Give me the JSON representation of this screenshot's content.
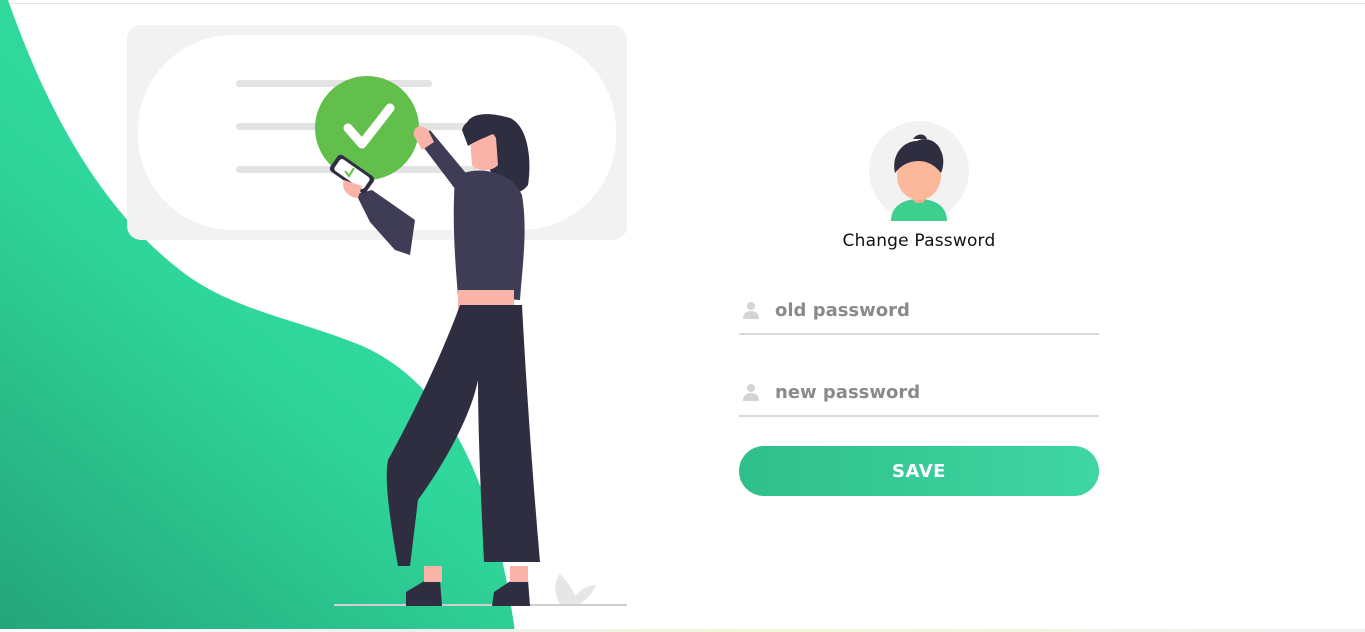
{
  "form": {
    "title": "Change Password",
    "old_password": {
      "value": "",
      "placeholder": "old password",
      "icon": "user-icon"
    },
    "new_password": {
      "value": "",
      "placeholder": "new password",
      "icon": "user-icon"
    },
    "save_label": "SAVE"
  },
  "illustration": {
    "check_icon": "check-icon",
    "phone_icon": "phone-icon"
  },
  "colors": {
    "accent_green": "#2fd69a",
    "accent_green_dark": "#22a678",
    "check_green": "#63bf4c",
    "card_gray": "#f2f2f2",
    "figure_top": "#3f3d56",
    "figure_pants": "#2f2e41",
    "skin": "#f9b3a8",
    "avatar_skin": "#fcb89b",
    "avatar_shirt": "#3ccf8e",
    "button_text": "#ffffff"
  }
}
